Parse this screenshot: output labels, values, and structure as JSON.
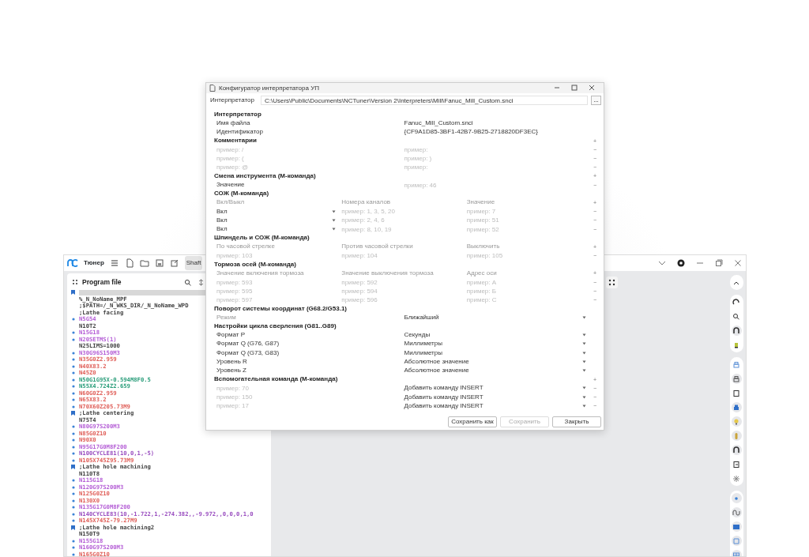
{
  "app": {
    "title": "Тюнер",
    "tab": "Shaft",
    "panel_title": "Program file",
    "lines": [
      {
        "kind": "bookmark",
        "selected": true
      },
      {
        "text": "%_N_NoName_MPF",
        "color": "#444444",
        "kind": "plain",
        "selected": false
      },
      {
        "text": ";$PATH=/_N_WKS_DIR/_N_NoName_WPD",
        "color": "#444444",
        "kind": "plain",
        "selected": false
      },
      {
        "text": ";Lathe facing",
        "color": "#444444",
        "kind": "plain",
        "selected": false
      },
      {
        "text": "N5G54",
        "color": "#b55fd6",
        "kind": "dot",
        "selected": false
      },
      {
        "text": "N10T2",
        "color": "#444444",
        "kind": "plain",
        "selected": false
      },
      {
        "text": "N15G18",
        "color": "#b55fd6",
        "kind": "dot",
        "selected": false
      },
      {
        "text": "N20SETMS(1)",
        "color": "#b55fd6",
        "kind": "dot",
        "selected": false
      },
      {
        "text": "N25LIMS=1000",
        "color": "#444444",
        "kind": "plain",
        "selected": false
      },
      {
        "text": "N30G96S150M3",
        "color": "#b55fd6",
        "kind": "dot",
        "selected": false
      },
      {
        "text": "N35G0Z2.959",
        "color": "#e0605a",
        "kind": "dot",
        "selected": false
      },
      {
        "text": "N40X83.2",
        "color": "#e0605a",
        "kind": "dot",
        "selected": false
      },
      {
        "text": "N45Z0",
        "color": "#e0605a",
        "kind": "dot",
        "selected": false
      },
      {
        "text": "N50G1G95X-0.594M8F0.5",
        "color": "#2a9d7a",
        "kind": "dot",
        "selected": false
      },
      {
        "text": "N55X4.724Z2.659",
        "color": "#2a9d7a",
        "kind": "dot",
        "selected": false
      },
      {
        "text": "N60G0Z2.959",
        "color": "#e0605a",
        "kind": "dot",
        "selected": false
      },
      {
        "text": "N65X83.2",
        "color": "#e0605a",
        "kind": "dot",
        "selected": false
      },
      {
        "text": "N70X60Z205.73M9",
        "color": "#e0605a",
        "kind": "dot",
        "selected": false
      },
      {
        "text": ";Lathe centering",
        "color": "#444444",
        "kind": "bookmark",
        "selected": false
      },
      {
        "text": "N75T4",
        "color": "#444444",
        "kind": "plain",
        "selected": false
      },
      {
        "text": "N80G97S200M3",
        "color": "#b55fd6",
        "kind": "dot",
        "selected": false
      },
      {
        "text": "N85G0Z10",
        "color": "#e0605a",
        "kind": "dot",
        "selected": false
      },
      {
        "text": "N90X0",
        "color": "#e0605a",
        "kind": "dot",
        "selected": false
      },
      {
        "text": "N95G17G0M8F200",
        "color": "#b55fd6",
        "kind": "dot",
        "selected": false
      },
      {
        "text": "N100CYCLE81(10,0,1,-5)",
        "color": "#9a4fc0",
        "kind": "dot",
        "selected": false
      },
      {
        "text": "N105X745Z95.73M9",
        "color": "#e0605a",
        "kind": "dot",
        "selected": false
      },
      {
        "text": ";Lathe hole machining",
        "color": "#444444",
        "kind": "bookmark",
        "selected": false
      },
      {
        "text": "N110T8",
        "color": "#444444",
        "kind": "plain",
        "selected": false
      },
      {
        "text": "N115G18",
        "color": "#b55fd6",
        "kind": "dot",
        "selected": false
      },
      {
        "text": "N120G97S200M3",
        "color": "#b55fd6",
        "kind": "dot",
        "selected": false
      },
      {
        "text": "N125G0Z10",
        "color": "#e0605a",
        "kind": "dot",
        "selected": false
      },
      {
        "text": "N130X0",
        "color": "#e0605a",
        "kind": "dot",
        "selected": false
      },
      {
        "text": "N135G17G0M8F200",
        "color": "#b55fd6",
        "kind": "dot",
        "selected": false
      },
      {
        "text": "N140CYCLE83(10,-1.722,1,-274.382,,-9.972,,0,0,0,1,0",
        "color": "#9a4fc0",
        "kind": "dot",
        "selected": false
      },
      {
        "text": "N145X745Z-79.27M9",
        "color": "#e0605a",
        "kind": "dot",
        "selected": false
      },
      {
        "text": ";Lathe hole machining2",
        "color": "#444444",
        "kind": "bookmark",
        "selected": false
      },
      {
        "text": "N150T9",
        "color": "#444444",
        "kind": "plain",
        "selected": false
      },
      {
        "text": "N155G18",
        "color": "#b55fd6",
        "kind": "dot",
        "selected": false
      },
      {
        "text": "N160G97S200M3",
        "color": "#b55fd6",
        "kind": "dot",
        "selected": false
      },
      {
        "text": "N165G0Z10",
        "color": "#e0605a",
        "kind": "dot",
        "selected": false
      }
    ]
  },
  "dialog": {
    "title": "Конфигуратор интерпретатора УП",
    "path_label": "Интерпретатор",
    "path": "C:\\Users\\Public\\Documents\\NCTuner\\Version 2\\Interpreters\\Mill\\Fanuc_Mill_Custom.snci",
    "browse": "...",
    "sections": [
      {
        "title": "Интерпретатор",
        "rows": [
          {
            "cells": [
              {
                "kind": "text",
                "text": "Имя файла"
              },
              {
                "kind": "text",
                "text": "Fanuc_Mill_Custom.snci"
              }
            ]
          },
          {
            "cells": [
              {
                "kind": "text",
                "text": "Идентификатор"
              },
              {
                "kind": "text",
                "text": "{CF9A1D85-3BF1-42B7-9B25-2718820DF3EC}"
              }
            ]
          }
        ]
      },
      {
        "title": "Комментарии",
        "action": "+",
        "rows": [
          {
            "cells": [
              {
                "kind": "input",
                "placeholder": "пример: /"
              },
              {
                "kind": "input",
                "placeholder": "пример:"
              }
            ],
            "action": "−"
          },
          {
            "cells": [
              {
                "kind": "input",
                "placeholder": "пример: ("
              },
              {
                "kind": "input",
                "placeholder": "пример: )"
              }
            ],
            "action": "−"
          },
          {
            "cells": [
              {
                "kind": "input",
                "placeholder": "пример: @"
              },
              {
                "kind": "input",
                "placeholder": "пример:"
              }
            ],
            "action": "−"
          }
        ]
      },
      {
        "title": "Смена инструмента (М-команда)",
        "action": "+",
        "rows": [
          {
            "cells": [
              {
                "kind": "text",
                "text": "Значение"
              },
              {
                "kind": "input",
                "placeholder": "пример: 46"
              }
            ],
            "action": "−"
          }
        ]
      },
      {
        "title": "СОЖ (М-команда)",
        "rows": [
          {
            "cells": [
              {
                "kind": "header",
                "text": "Вкл/Выкл"
              },
              {
                "kind": "header",
                "text": "Номера каналов"
              },
              {
                "kind": "header",
                "text": "Значение"
              }
            ],
            "action": "+"
          },
          {
            "cells": [
              {
                "kind": "select",
                "text": "Вкл"
              },
              {
                "kind": "input",
                "placeholder": "пример: 1, 3, 5, 20"
              },
              {
                "kind": "input",
                "placeholder": "пример: 7"
              }
            ],
            "action": "−"
          },
          {
            "cells": [
              {
                "kind": "select",
                "text": "Вкл"
              },
              {
                "kind": "input",
                "placeholder": "пример: 2, 4, 6"
              },
              {
                "kind": "input",
                "placeholder": "пример: 51"
              }
            ],
            "action": "−"
          },
          {
            "cells": [
              {
                "kind": "select",
                "text": "Вкл"
              },
              {
                "kind": "input",
                "placeholder": "пример: 8, 10, 19"
              },
              {
                "kind": "input",
                "placeholder": "пример: 52"
              }
            ],
            "action": "−"
          }
        ]
      },
      {
        "title": "Шпиндель и СОЖ (М-команда)",
        "rows": [
          {
            "cells": [
              {
                "kind": "header",
                "text": "По часовой стрелке"
              },
              {
                "kind": "header",
                "text": "Против часовой стрелки"
              },
              {
                "kind": "header",
                "text": "Выключить"
              }
            ],
            "action": "+"
          },
          {
            "cells": [
              {
                "kind": "input",
                "placeholder": "пример: 103"
              },
              {
                "kind": "input",
                "placeholder": "пример: 104"
              },
              {
                "kind": "input",
                "placeholder": "пример: 105"
              }
            ],
            "action": "−"
          }
        ]
      },
      {
        "title": "Тормоза осей (М-команда)",
        "rows": [
          {
            "cells": [
              {
                "kind": "header",
                "text": "Значение включения тормоза"
              },
              {
                "kind": "header",
                "text": "Значение выключения тормоза"
              },
              {
                "kind": "header",
                "text": "Адрес оси"
              }
            ],
            "action": "+"
          },
          {
            "cells": [
              {
                "kind": "input",
                "placeholder": "пример: 593"
              },
              {
                "kind": "input",
                "placeholder": "пример: 592"
              },
              {
                "kind": "input",
                "placeholder": "пример: A"
              }
            ],
            "action": "−"
          },
          {
            "cells": [
              {
                "kind": "input",
                "placeholder": "пример: 595"
              },
              {
                "kind": "input",
                "placeholder": "пример: 594"
              },
              {
                "kind": "input",
                "placeholder": "пример: Б"
              }
            ],
            "action": "−"
          },
          {
            "cells": [
              {
                "kind": "input",
                "placeholder": "пример: 597"
              },
              {
                "kind": "input",
                "placeholder": "пример: 596"
              },
              {
                "kind": "input",
                "placeholder": "пример: C"
              }
            ],
            "action": "−"
          }
        ]
      },
      {
        "title": "Поворот системы координат (G68.2/G53.1)",
        "rows": [
          {
            "cells": [
              {
                "kind": "header",
                "text": "Режим"
              },
              {
                "kind": "select",
                "text": "Ближайший"
              }
            ]
          }
        ]
      },
      {
        "title": "Настройки цикла сверления (G81..G89)",
        "rows": [
          {
            "cells": [
              {
                "kind": "text",
                "text": "Формат P"
              },
              {
                "kind": "select",
                "text": "Секунды"
              }
            ]
          },
          {
            "cells": [
              {
                "kind": "text",
                "text": "Формат Q (G76, G87)"
              },
              {
                "kind": "select",
                "text": "Миллиметры"
              }
            ]
          },
          {
            "cells": [
              {
                "kind": "text",
                "text": "Формат Q (G73, G83)"
              },
              {
                "kind": "select",
                "text": "Миллиметры"
              }
            ]
          },
          {
            "cells": [
              {
                "kind": "text",
                "text": "Уровень R"
              },
              {
                "kind": "select",
                "text": "Абсолютное значение"
              }
            ]
          },
          {
            "cells": [
              {
                "kind": "text",
                "text": "Уровень Z"
              },
              {
                "kind": "select",
                "text": "Абсолютное значение"
              }
            ]
          }
        ]
      },
      {
        "title": "Вспомогательная команда (М-команда)",
        "action": "+",
        "rows": [
          {
            "cells": [
              {
                "kind": "input",
                "placeholder": "пример: 70"
              },
              {
                "kind": "select",
                "text": "Добавить команду INSERT"
              }
            ],
            "action": "−"
          },
          {
            "cells": [
              {
                "kind": "input",
                "placeholder": "пример: 150"
              },
              {
                "kind": "select",
                "text": "Добавить команду INSERT"
              }
            ],
            "action": "−"
          },
          {
            "cells": [
              {
                "kind": "input",
                "placeholder": "пример: 17"
              },
              {
                "kind": "select",
                "text": "Добавить команду INSERT"
              }
            ],
            "action": "−"
          }
        ]
      }
    ],
    "buttons": [
      {
        "label": "Сохранить как",
        "disabled": false
      },
      {
        "label": "Сохранить",
        "disabled": true
      },
      {
        "label": "Закрыть",
        "disabled": false
      }
    ]
  }
}
